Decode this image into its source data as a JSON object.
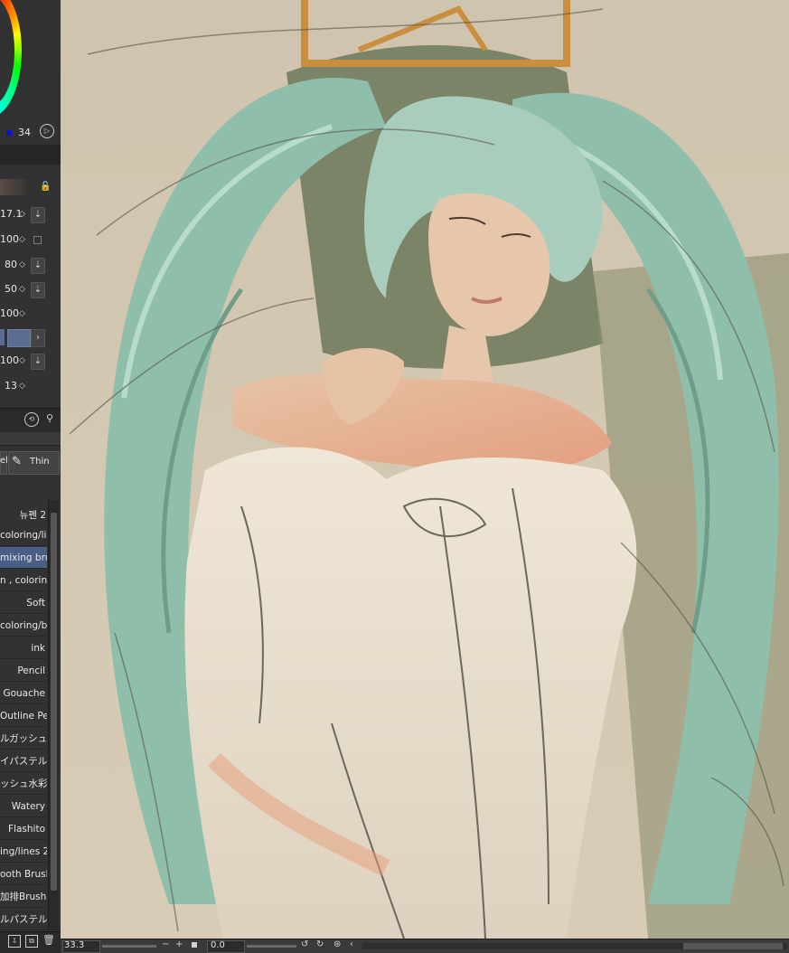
{
  "color_panel": {
    "value_label": "34"
  },
  "tool_properties": {
    "rows": [
      {
        "value": "17.1"
      },
      {
        "value": "100"
      },
      {
        "value": "80"
      },
      {
        "value": "50"
      },
      {
        "value": "100"
      },
      {
        "value": ""
      },
      {
        "value": "100"
      },
      {
        "value": "13"
      }
    ]
  },
  "subtool_tabs": {
    "tab1": "el",
    "tab2": "Thin"
  },
  "brush_list": {
    "group_label": "뉴펜 2",
    "items": [
      "coloring/lines",
      "mixing brush",
      "n , coloring",
      "Soft",
      "coloring/bgs",
      "ink",
      "Pencil",
      "Gouache",
      "Outline Pen",
      "ルガッシュ",
      "イパステル",
      "ッシュ水彩",
      "Watery",
      "Flashito",
      "ing/lines 2",
      "ooth Brush",
      "加排Brush",
      "ルパステル"
    ],
    "selected_index": 1
  },
  "status_bar": {
    "zoom": "33.3",
    "rotation": "0.0"
  },
  "colors": {
    "panel": "#323232",
    "selected": "#4b5f86",
    "canvas_bg": "#d9cdb6",
    "hair": "#8fbfab"
  }
}
